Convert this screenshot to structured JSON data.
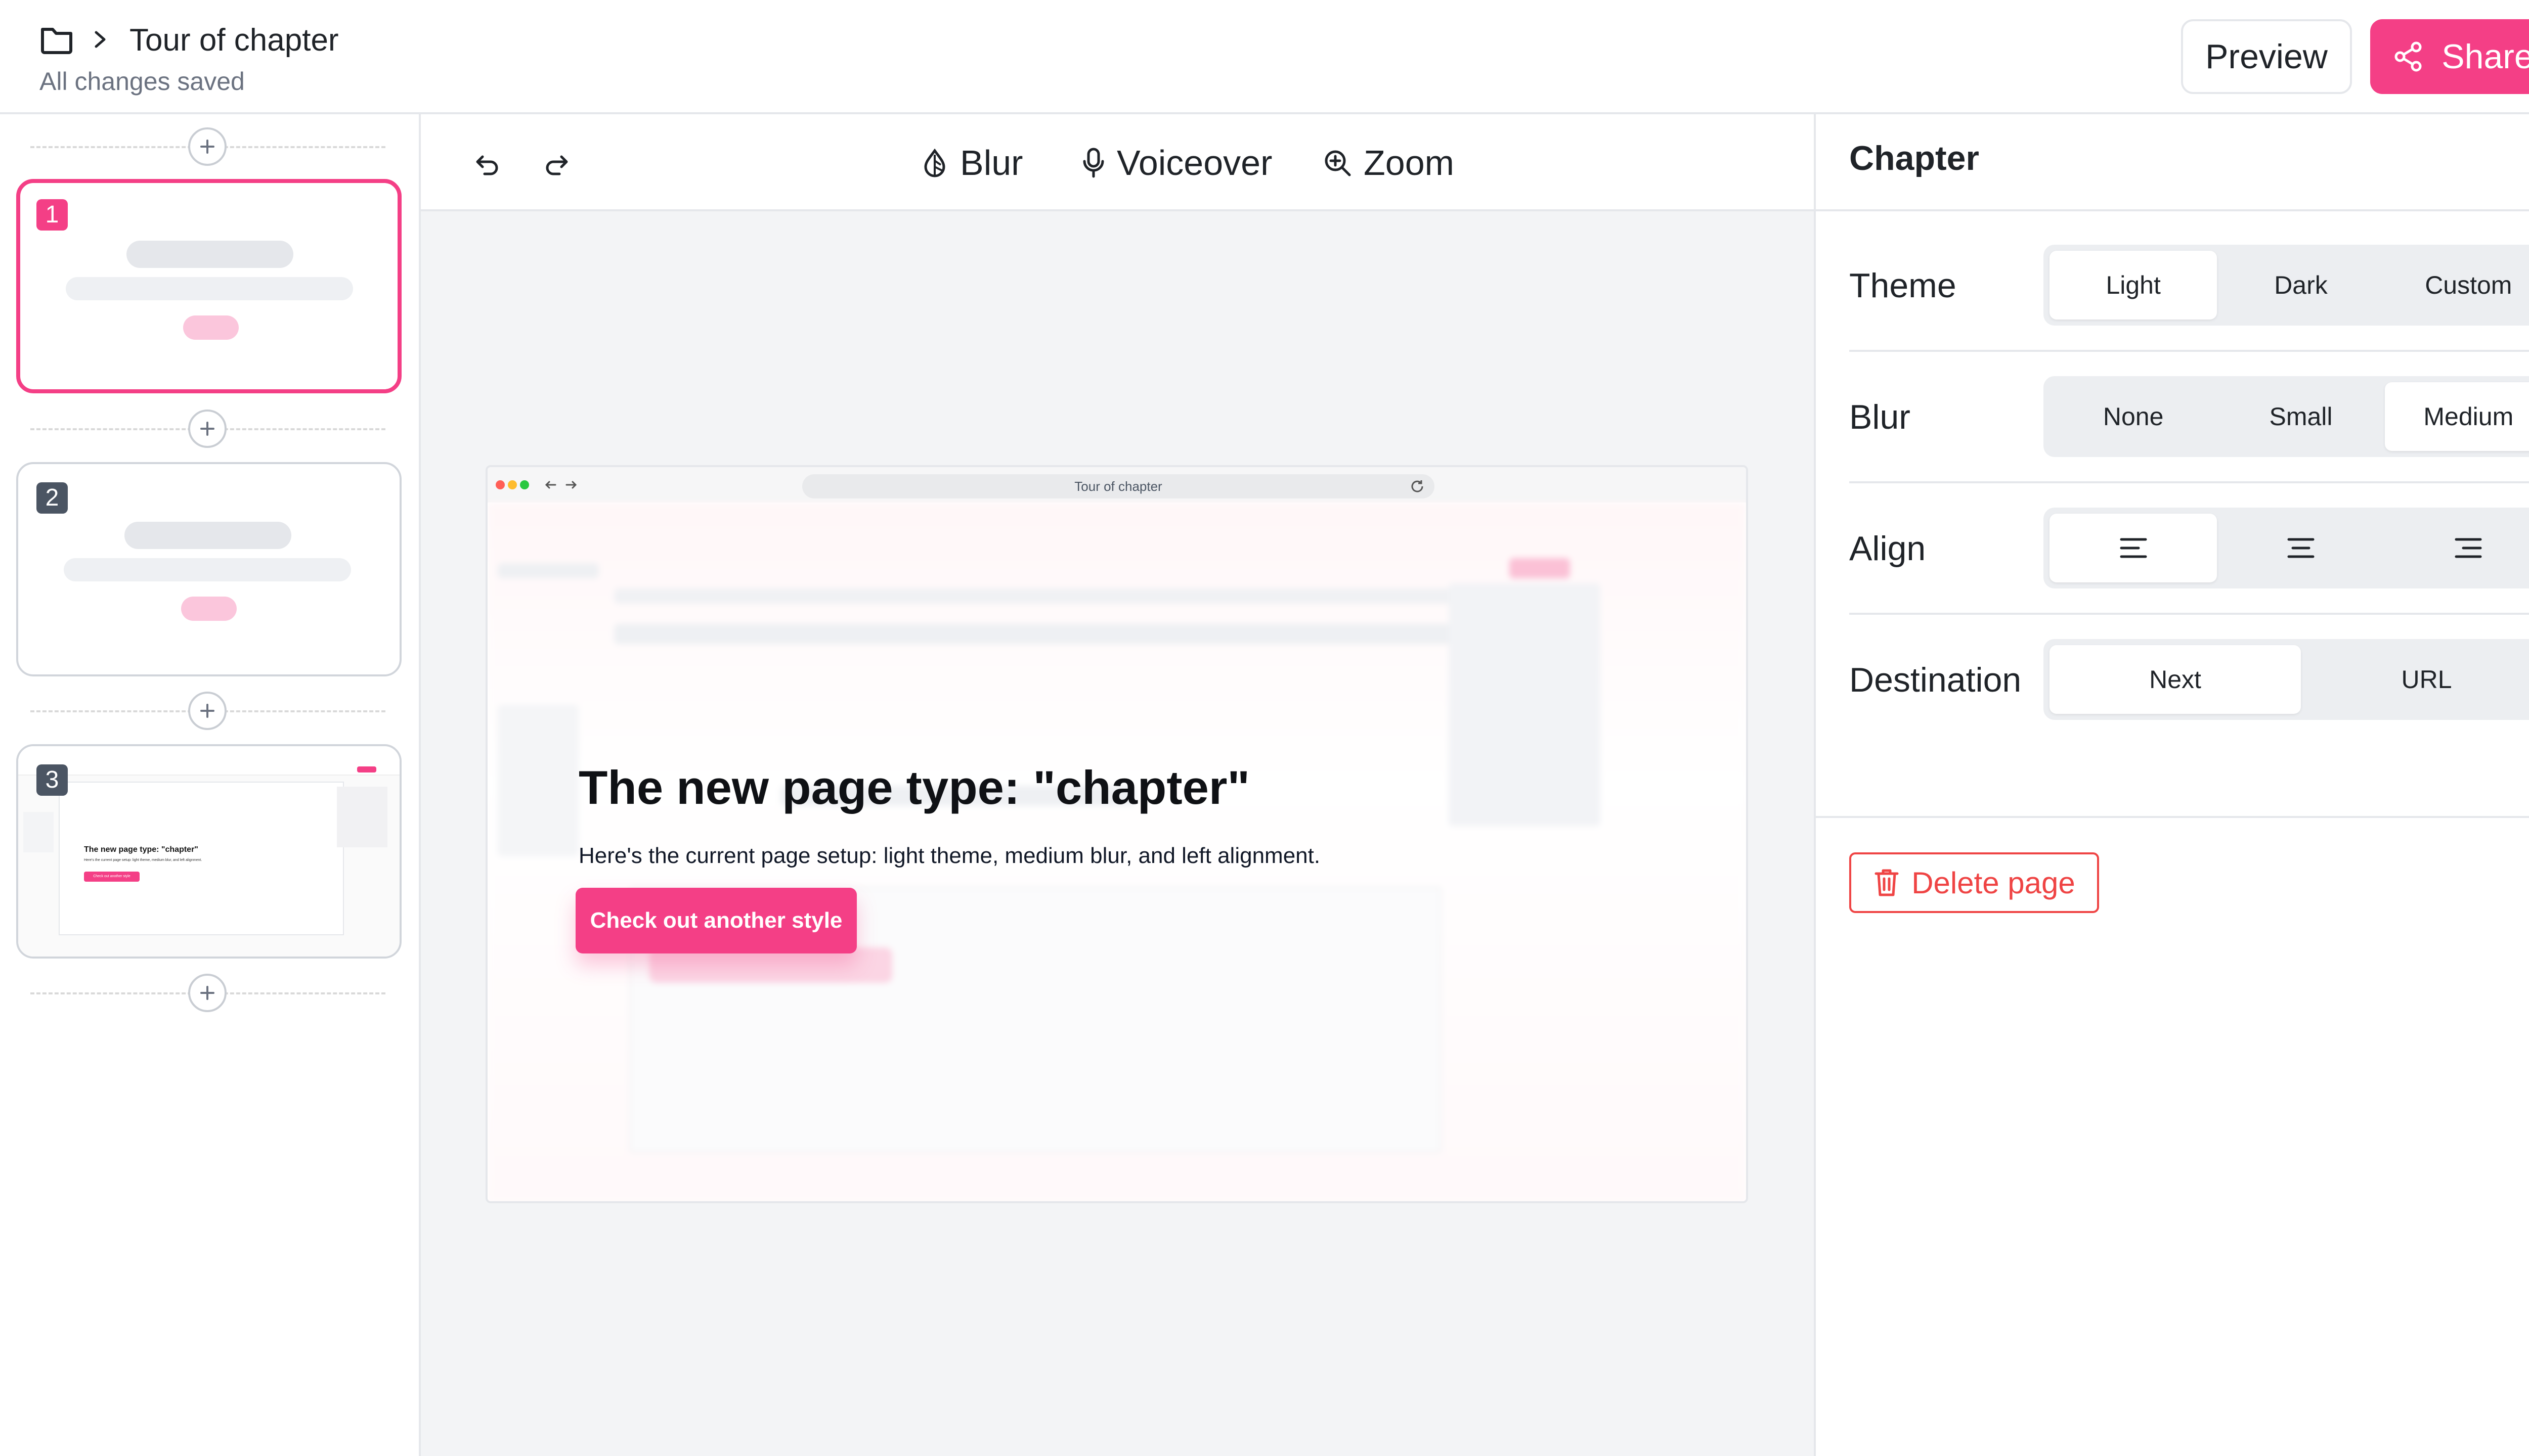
{
  "header": {
    "icons": {
      "folder": "folder-icon",
      "chevron": "chevron-right-icon"
    },
    "title": "Tour of chapter",
    "status": "All changes saved",
    "preview_label": "Preview",
    "share_label": "Share",
    "share_icon": "share-icon"
  },
  "sidebar": {
    "pages": [
      {
        "number": "1",
        "selected": true
      },
      {
        "number": "2",
        "selected": false
      },
      {
        "number": "3",
        "selected": false
      }
    ],
    "add_icon": "plus-icon",
    "thumb3": {
      "title": "The new page type: \"chapter\"",
      "text": "Here's the current page setup: light theme, medium blur, and left alignment.",
      "button": "Check out another style"
    }
  },
  "toolbar": {
    "undo_icon": "undo-icon",
    "redo_icon": "redo-icon",
    "blur_label": "Blur",
    "voiceover_label": "Voiceover",
    "zoom_label": "Zoom"
  },
  "canvas": {
    "browser": {
      "url_title": "Tour of chapter",
      "reload_icon": "reload-icon"
    },
    "chapter": {
      "title": "The new page type: \"chapter\"",
      "description": "Here's the current page setup: light theme, medium blur, and left alignment.",
      "cta": "Check out another style"
    }
  },
  "panel": {
    "title": "Chapter",
    "theme": {
      "label": "Theme",
      "options": [
        "Light",
        "Dark",
        "Custom"
      ],
      "selected": "Light"
    },
    "blur": {
      "label": "Blur",
      "options": [
        "None",
        "Small",
        "Medium"
      ],
      "selected": "Medium"
    },
    "align": {
      "label": "Align",
      "options": [
        "align-left-icon",
        "align-center-icon",
        "align-right-icon"
      ],
      "selected": "align-left-icon"
    },
    "destination": {
      "label": "Destination",
      "options": [
        "Next",
        "URL"
      ],
      "selected": "Next"
    },
    "delete_label": "Delete page"
  },
  "colors": {
    "accent": "#f43f86",
    "danger": "#ef4444",
    "canvas_bg": "#f3f4f6",
    "border": "#e5e7eb"
  }
}
